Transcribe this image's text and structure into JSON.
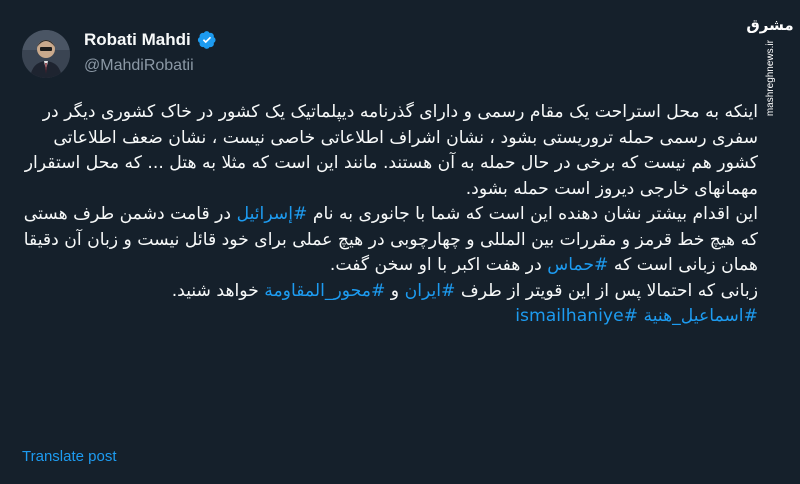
{
  "author": {
    "display_name": "Robati Mahdi",
    "handle": "@MahdiRobatii",
    "verified": true
  },
  "watermark": {
    "logo_text": "مشرق",
    "url_text": "mashreghnews.ir"
  },
  "post": {
    "paragraph1": "اینکه به محل استراحت یک مقام رسمی و دارای گذرنامه دیپلماتیک یک کشور در خاک کشوری دیگر در سفری رسمی حمله تروریستی بشود ، نشان اشراف اطلاعاتی خاصی نیست ، نشان ضعف اطلاعاتی کشور هم نیست که برخی در حال حمله به آن هستند. مانند این است که مثلا به هتل ... که محل استقرار مهمانهای خارجی دیروز است حمله بشود.",
    "p2_part1": "این اقدام بیشتر نشان دهنده این است که شما با جانوری به نام ",
    "p2_tag1": "#إسرائيل",
    "p2_part2": " در قامت دشمن طرف هستی که هیچ خط قرمز و مقررات بین المللی و چهارچوبی در هیچ عملی برای خود قائل نیست و زبان آن دقیقا همان زبانی است که ",
    "p2_tag2": "#حماس",
    "p2_part3": " در هفت اکبر با او سخن گفت.",
    "p3_part1": "زبانی که احتمالا پس از این قویتر از طرف ",
    "p3_tag1": "#ایران",
    "p3_part2": " و ",
    "p3_tag2": "#محور_المقاومة",
    "p3_part3": " خواهد شنید.",
    "p4_tag1": "#اسماعیل_هنية",
    "p4_tag2": "#ismailhaniye"
  },
  "actions": {
    "translate_label": "Translate post"
  },
  "colors": {
    "background": "#15202b",
    "text": "#f7f9f9",
    "secondary": "#8b98a5",
    "link": "#1d9bf0",
    "verified": "#1d9bf0"
  }
}
